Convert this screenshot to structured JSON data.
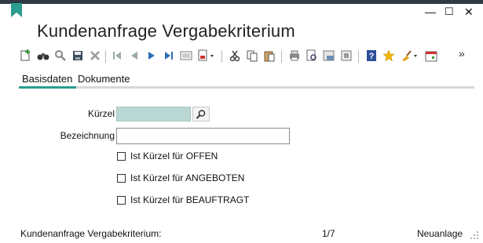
{
  "window": {
    "title": "Kundenanfrage Vergabekriterium",
    "minimize_glyph": "—",
    "maximize_glyph": "☐",
    "close_glyph": "✕",
    "accent_color": "#2a9d8f"
  },
  "toolbar": {
    "overflow_glyph": "»",
    "icons": [
      "new-record-icon",
      "binoculars-icon",
      "search-icon",
      "save-icon",
      "delete-icon",
      "first-record-icon",
      "previous-record-icon",
      "next-record-icon",
      "last-record-icon",
      "list-view-icon",
      "report-dropdown-icon",
      "cut-icon",
      "copy-icon",
      "paste-icon",
      "print-icon",
      "print-preview-icon",
      "print-setup-icon",
      "zoom-icon",
      "help-icon",
      "favorite-star-icon",
      "clean-broom-icon",
      "calendar-icon"
    ]
  },
  "tabs": [
    {
      "label": "Basisdaten",
      "active": true
    },
    {
      "label": "Dokumente",
      "active": false
    }
  ],
  "form": {
    "kuerzel_label": "Kürzel",
    "kuerzel_value": "",
    "bezeichnung_label": "Bezeichnung",
    "bezeichnung_value": "",
    "checkboxes": [
      {
        "label": "Ist Kürzel für OFFEN",
        "checked": false
      },
      {
        "label": "Ist Kürzel für ANGEBOTEN",
        "checked": false
      },
      {
        "label": "Ist Kürzel für BEAUFTRAGT",
        "checked": false
      }
    ]
  },
  "status_bar": {
    "left": "Kundenanfrage Vergabekriterium:",
    "record_position": "1/7",
    "mode": "Neuanlage"
  }
}
